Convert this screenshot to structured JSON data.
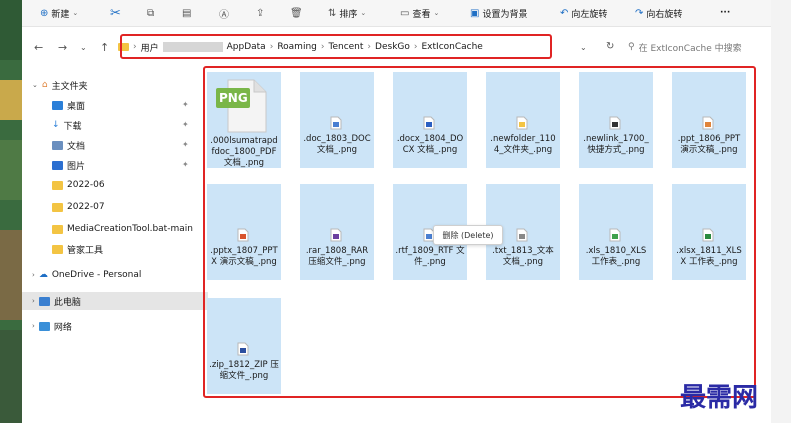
{
  "toolbar": {
    "new_label": "新建",
    "sort_label": "排序",
    "view_label": "查看",
    "set_background_label": "设置为背景",
    "rotate_left_label": "向左旋转",
    "rotate_right_label": "向右旋转",
    "more_label": "···"
  },
  "address": {
    "segments": [
      "用户",
      "AppData",
      "Roaming",
      "Tencent",
      "DeskGo",
      "ExtIconCache"
    ],
    "separator": "›"
  },
  "search": {
    "placeholder": "在 ExtIconCache 中搜索"
  },
  "sidebar": {
    "home": "主文件夹",
    "items": [
      {
        "label": "桌面",
        "pinned": true
      },
      {
        "label": "下载",
        "pinned": true
      },
      {
        "label": "文档",
        "pinned": true
      },
      {
        "label": "图片",
        "pinned": true
      },
      {
        "label": "2022-06"
      },
      {
        "label": "2022-07"
      },
      {
        "label": "MediaCreationTool.bat-main"
      },
      {
        "label": "管家工具"
      }
    ],
    "onedrive": "OneDrive - Personal",
    "this_pc": "此电脑",
    "network": "网络"
  },
  "files": [
    {
      "name": ".000lsumatrapdfdoc_1800_PDF 文档_.png",
      "icon": "png-large-icon",
      "color": "#6cb33f"
    },
    {
      "name": ".doc_1803_DOC 文档_.png",
      "icon": "doc-icon",
      "color": "#4a7fd1"
    },
    {
      "name": ".docx_1804_DOCX 文档_.png",
      "icon": "docx-icon",
      "color": "#2b5fc2"
    },
    {
      "name": ".newfolder_1104_文件夹_.png",
      "icon": "folder-icon",
      "color": "#f3c443"
    },
    {
      "name": ".newlink_1700_快捷方式_.png",
      "icon": "shortcut-icon",
      "color": "#333333"
    },
    {
      "name": ".ppt_1806_PPT 演示文稿_.png",
      "icon": "ppt-icon",
      "color": "#e0843a"
    },
    {
      "name": ".pptx_1807_PPTX 演示文稿_.png",
      "icon": "pptx-icon",
      "color": "#d9532c"
    },
    {
      "name": ".rar_1808_RAR 压缩文件_.png",
      "icon": "rar-icon",
      "color": "#6b3fa0"
    },
    {
      "name": ".rtf_1809_RTF 文件_.png",
      "icon": "rtf-icon",
      "color": "#4a7fd1"
    },
    {
      "name": ".txt_1813_文本文档_.png",
      "icon": "txt-icon",
      "color": "#888888"
    },
    {
      "name": ".xls_1810_XLS 工作表_.png",
      "icon": "xls-icon",
      "color": "#3fa14c"
    },
    {
      "name": ".xlsx_1811_XLSX 工作表_.png",
      "icon": "xlsx-icon",
      "color": "#2b8a3e"
    },
    {
      "name": ".zip_1812_ZIP 压缩文件_.png",
      "icon": "zip-icon",
      "color": "#2b4fa0"
    }
  ],
  "png_badge": "PNG",
  "tooltip": "删除 (Delete)",
  "watermark": "最需网"
}
